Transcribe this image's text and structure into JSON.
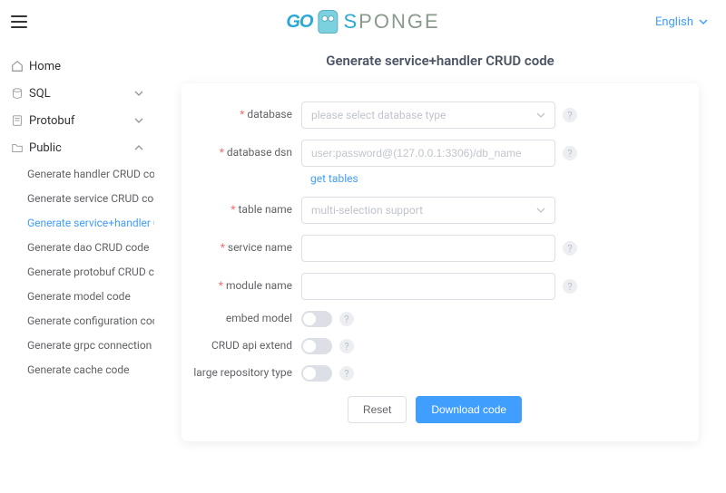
{
  "header": {
    "language": "English"
  },
  "sidebar": {
    "home": "Home",
    "sql": "SQL",
    "protobuf": "Protobuf",
    "public": {
      "label": "Public",
      "items": [
        "Generate handler CRUD code",
        "Generate service CRUD code",
        "Generate service+handler CRUD",
        "Generate dao CRUD code",
        "Generate protobuf CRUD code",
        "Generate model code",
        "Generate configuration code",
        "Generate grpc connection code",
        "Generate cache code"
      ],
      "active_index": 2
    }
  },
  "page": {
    "title": "Generate service+handler CRUD code"
  },
  "form": {
    "database": {
      "label": "database",
      "placeholder": "please select database type"
    },
    "dsn": {
      "label": "database dsn",
      "placeholder": "user:password@(127.0.0.1:3306)/db_name"
    },
    "get_tables": "get tables",
    "table_name": {
      "label": "table name",
      "placeholder": "multi-selection support"
    },
    "service_name": {
      "label": "service name"
    },
    "module_name": {
      "label": "module name"
    },
    "embed_model": {
      "label": "embed model"
    },
    "crud_api_extend": {
      "label": "CRUD api extend"
    },
    "large_repo": {
      "label": "large repository type"
    },
    "reset": "Reset",
    "download": "Download code"
  }
}
